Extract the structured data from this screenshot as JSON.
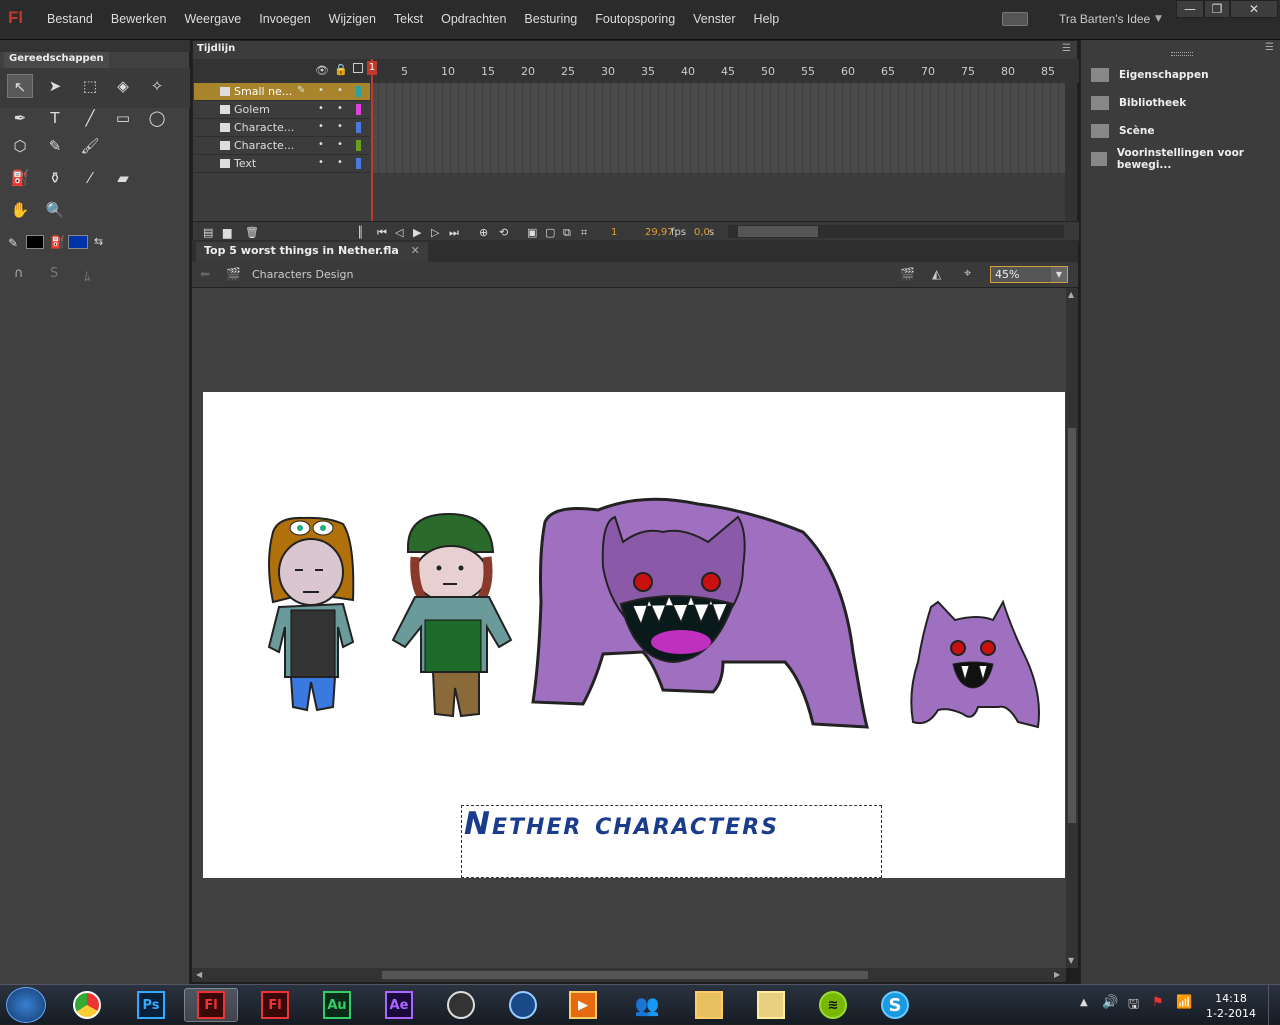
{
  "app": {
    "logo": "Fl"
  },
  "menu": [
    "Bestand",
    "Bewerken",
    "Weergave",
    "Invoegen",
    "Wijzigen",
    "Tekst",
    "Opdrachten",
    "Besturing",
    "Foutopsporing",
    "Venster",
    "Help"
  ],
  "workspace": {
    "label": "Tra Barten's Idee"
  },
  "window_buttons": {
    "minimize": "—",
    "restore": "❐",
    "close": "✕"
  },
  "tools_panel": {
    "title": "Gereedschappen"
  },
  "timeline": {
    "title": "Tijdlijn",
    "frame_numbers": [
      "1",
      "5",
      "10",
      "15",
      "20",
      "25",
      "30",
      "35",
      "40",
      "45",
      "50",
      "55",
      "60",
      "65",
      "70",
      "75",
      "80",
      "85"
    ],
    "layers": [
      {
        "name": "Small ne...",
        "color": "#2aa0a0",
        "selected": true
      },
      {
        "name": "Golem",
        "color": "#e040e0",
        "selected": false
      },
      {
        "name": "Characte...",
        "color": "#4a7ae0",
        "selected": false
      },
      {
        "name": "Characte...",
        "color": "#6aa020",
        "selected": false
      },
      {
        "name": "Text",
        "color": "#4a7ae0",
        "selected": false
      }
    ],
    "current_frame": "1",
    "fps": "29,97",
    "fps_unit": "fps",
    "time": "0,0",
    "time_unit": "s"
  },
  "document": {
    "tab": "Top 5 worst things in Nether.fla",
    "breadcrumb": "Characters Design",
    "zoom": "45%"
  },
  "stage": {
    "title_text": "Nether characters"
  },
  "right_panel": {
    "items": [
      "Eigenschappen",
      "Bibliotheek",
      "Scène",
      "Voorinstellingen voor bewegi..."
    ]
  },
  "taskbar": {
    "apps": [
      "Chrome",
      "Ps",
      "Fl",
      "Fl",
      "Au",
      "Ae",
      "Tool",
      "Media",
      "Player",
      "Messenger",
      "Explorer",
      "Folder",
      "Spotify",
      "Skype"
    ],
    "clock": {
      "time": "14:18",
      "date": "1-2-2014"
    }
  }
}
